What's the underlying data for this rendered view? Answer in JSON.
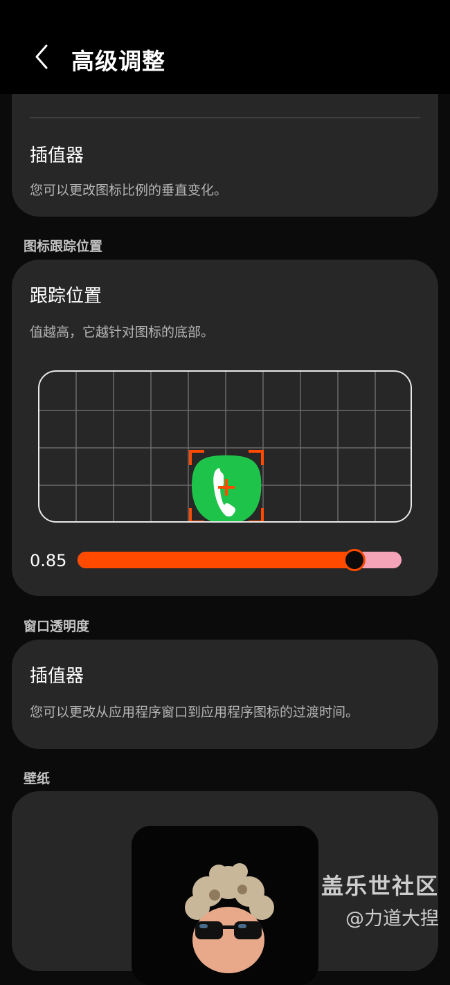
{
  "header": {
    "title": "高级调整"
  },
  "icon_tracking_section": {
    "label": "图标跟踪位置"
  },
  "window_opacity_section": {
    "label": "窗口透明度"
  },
  "wallpaper_section": {
    "label": "壁纸"
  },
  "top_card": {
    "title": "插值器",
    "description": "您可以更改图标比例的垂直变化。"
  },
  "tracking_card": {
    "title": "跟踪位置",
    "description": "值越高，它越针对图标的底部。",
    "slider_value_label": "0.85",
    "slider_value": 0.85
  },
  "opacity_card": {
    "title": "插值器",
    "description": "您可以更改从应用程序窗口到应用程序图标的过渡时间。"
  },
  "colors": {
    "accent": "#ff4a00",
    "track_inactive": "#f4a4b6",
    "card_bg": "#272727",
    "page_bg": "#0b0b0b",
    "phone_green": "#1ec44a"
  },
  "watermark": {
    "line1": "盖乐世社区",
    "line2": "@力道大揑"
  }
}
